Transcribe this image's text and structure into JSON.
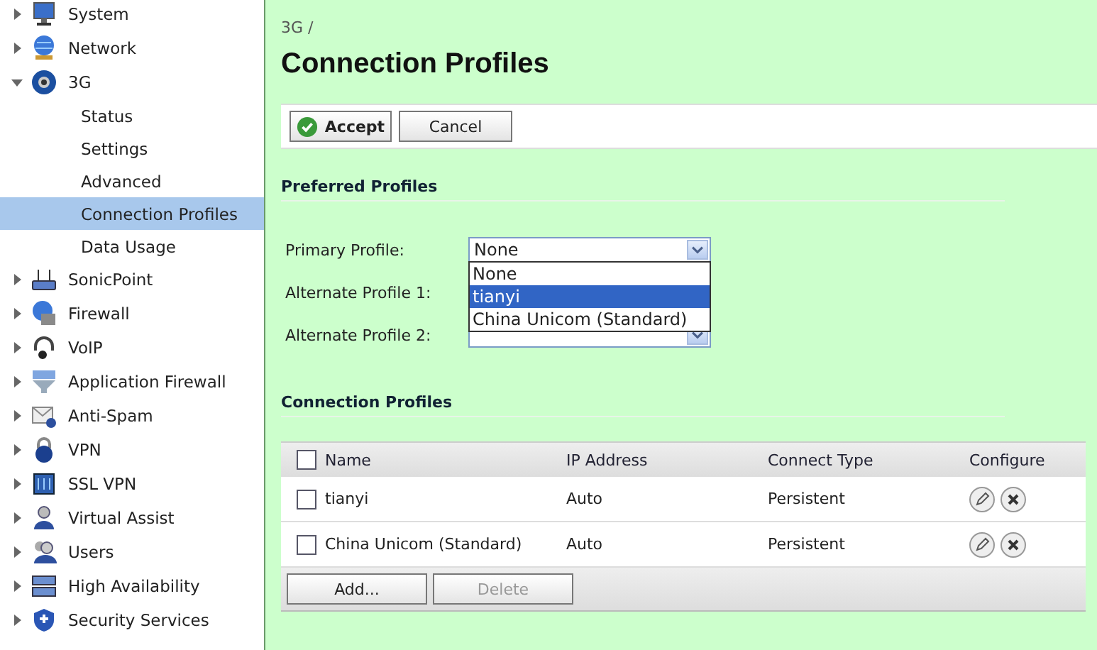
{
  "sidebar": {
    "items": [
      {
        "label": "System",
        "expanded": false
      },
      {
        "label": "Network",
        "expanded": false
      },
      {
        "label": "3G",
        "expanded": true,
        "children": [
          {
            "label": "Status",
            "selected": false
          },
          {
            "label": "Settings",
            "selected": false
          },
          {
            "label": "Advanced",
            "selected": false
          },
          {
            "label": "Connection Profiles",
            "selected": true
          },
          {
            "label": "Data Usage",
            "selected": false
          }
        ]
      },
      {
        "label": "SonicPoint",
        "expanded": false
      },
      {
        "label": "Firewall",
        "expanded": false
      },
      {
        "label": "VoIP",
        "expanded": false
      },
      {
        "label": "Application Firewall",
        "expanded": false
      },
      {
        "label": "Anti-Spam",
        "expanded": false
      },
      {
        "label": "VPN",
        "expanded": false
      },
      {
        "label": "SSL VPN",
        "expanded": false
      },
      {
        "label": "Virtual Assist",
        "expanded": false
      },
      {
        "label": "Users",
        "expanded": false
      },
      {
        "label": "High Availability",
        "expanded": false
      },
      {
        "label": "Security Services",
        "expanded": false
      }
    ]
  },
  "breadcrumb": "3G /",
  "title": "Connection Profiles",
  "toolbar": {
    "buttons": [
      {
        "label": "Accept",
        "kind": "accept"
      },
      {
        "label": "Cancel",
        "kind": "plain"
      }
    ]
  },
  "preferred_profiles": {
    "heading": "Preferred Profiles",
    "fields": [
      {
        "label": "Primary Profile:",
        "kind": "select",
        "value": "None"
      },
      {
        "label": "Alternate Profile 1:",
        "kind": "covered"
      },
      {
        "label": "Alternate Profile 2:",
        "kind": "select"
      }
    ],
    "dropdown": {
      "options": [
        {
          "label": "None",
          "selected": false
        },
        {
          "label": "tianyi",
          "selected": true
        },
        {
          "label": "China Unicom (Standard)",
          "selected": false
        }
      ]
    }
  },
  "connection_profiles": {
    "heading": "Connection Profiles",
    "columns": [
      "Name",
      "IP Address",
      "Connect Type",
      "Configure"
    ],
    "header_checked": false,
    "rows": [
      {
        "name": "tianyi",
        "ip_address": "Auto",
        "connect_type": "Persistent",
        "checked": false
      },
      {
        "name": "China Unicom (Standard)",
        "ip_address": "Auto",
        "connect_type": "Persistent",
        "checked": false
      }
    ],
    "buttons": [
      {
        "label": "Add...",
        "disabled": false
      },
      {
        "label": "Delete",
        "disabled": true
      }
    ]
  }
}
